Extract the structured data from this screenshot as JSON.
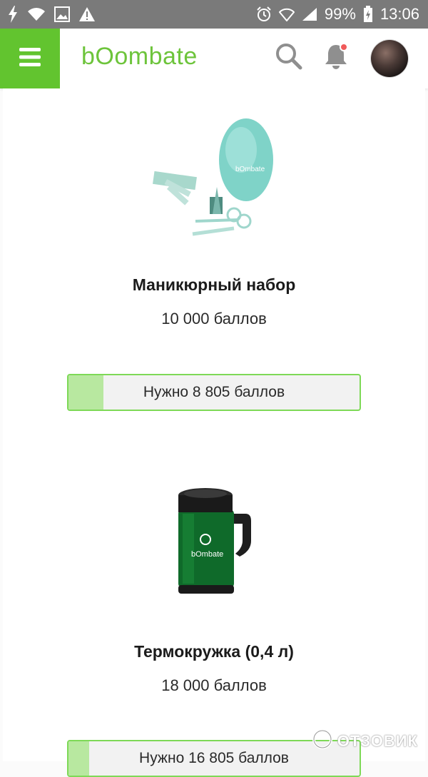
{
  "status_bar": {
    "battery": "99%",
    "time": "13:06"
  },
  "header": {
    "logo": "bOombate",
    "icons": [
      "menu-icon",
      "search-icon",
      "bell-icon",
      "avatar"
    ],
    "colors": {
      "brand_green": "#62c42f",
      "logo_green": "#6dc43b",
      "notification": "#f05a5a"
    }
  },
  "products": [
    {
      "name": "Маникюрный набор",
      "price": "10 000 баллов",
      "need_label": "Нужно 8 805 баллов",
      "progress_fraction": 0.12
    },
    {
      "name": "Термокружка (0,4 л)",
      "price": "18 000 баллов",
      "need_label": "Нужно 16 805 баллов",
      "progress_fraction": 0.07
    }
  ],
  "watermark": "ОТЗОВИК"
}
